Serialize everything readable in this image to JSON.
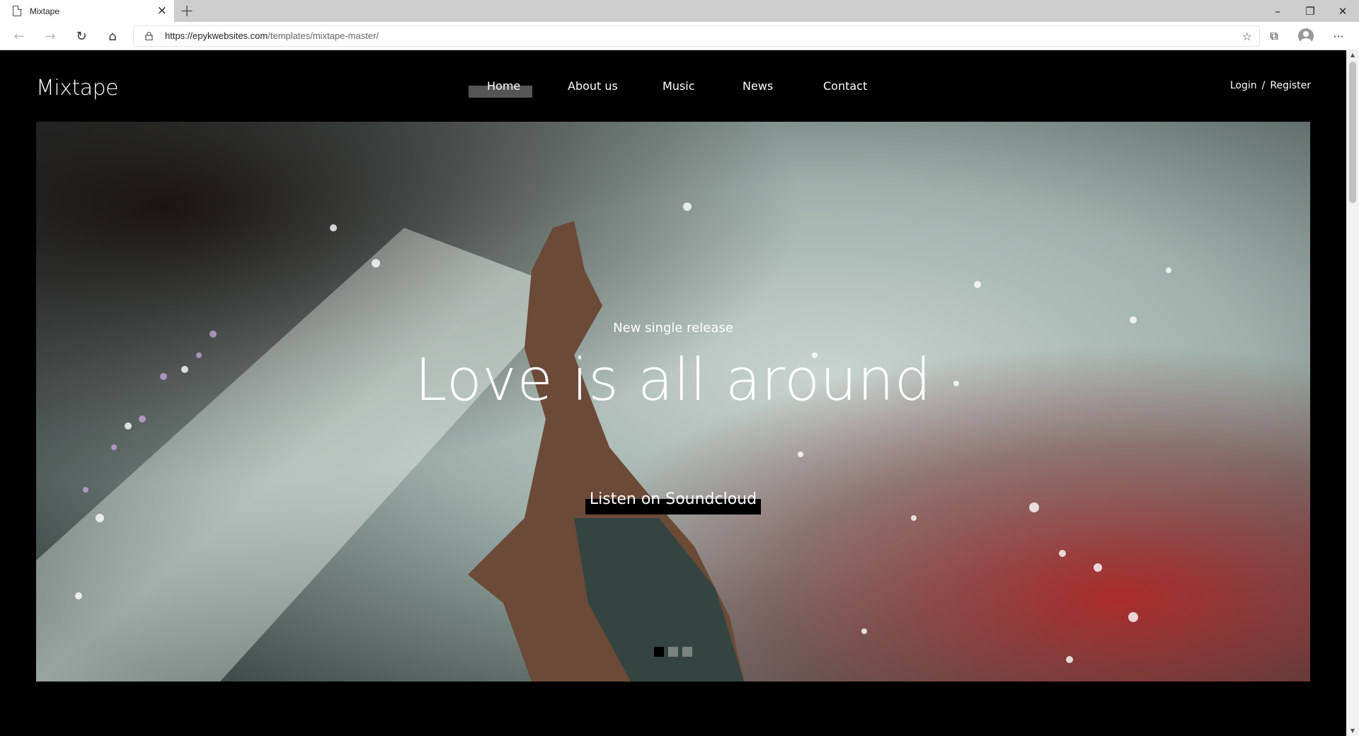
{
  "browser": {
    "tab_title": "Mixtape",
    "url_host": "https://epykwebsites.com",
    "url_path": "/templates/mixtape-master/"
  },
  "site": {
    "logo": "Mixtape",
    "nav": [
      {
        "label": "Home"
      },
      {
        "label": "About us"
      },
      {
        "label": "Music"
      },
      {
        "label": "News"
      },
      {
        "label": "Contact"
      }
    ],
    "auth": {
      "login": "Login",
      "separator": "/",
      "register": "Register"
    }
  },
  "hero": {
    "subtitle": "New single release",
    "title": "Love is all around",
    "cta": "Listen on Soundcloud",
    "slides_total": 3,
    "slide_active": 1
  },
  "colors": {
    "background": "#000000",
    "home_highlight": "#555555",
    "text": "#ffffff"
  }
}
